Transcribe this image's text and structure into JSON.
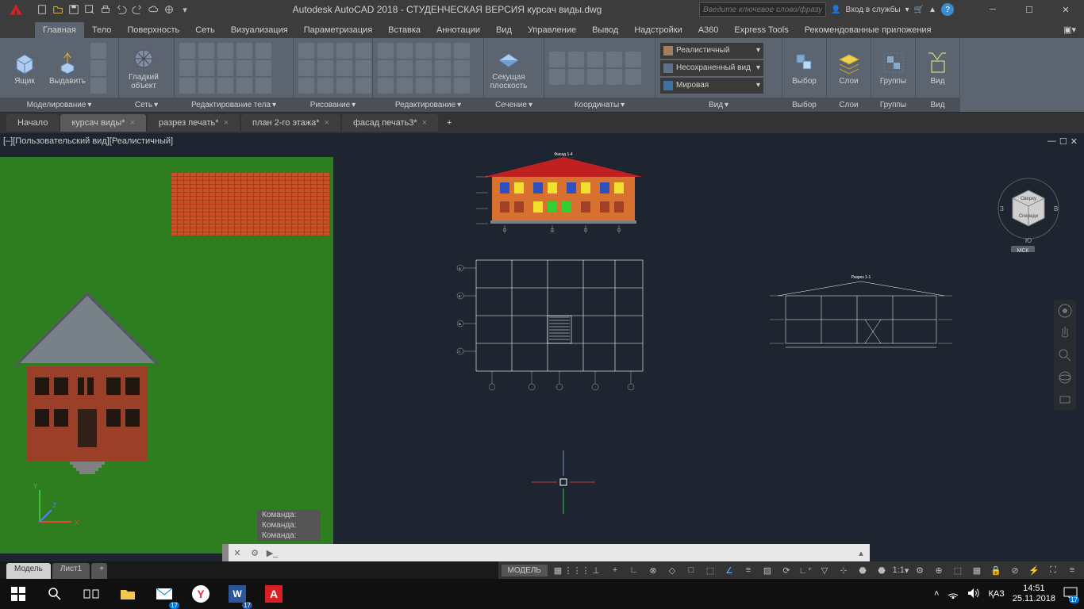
{
  "title": "Autodesk AutoCAD 2018 - СТУДЕНЧЕСКАЯ ВЕРСИЯ   курсач виды.dwg",
  "search_placeholder": "Введите ключевое слово/фразу",
  "signin": "Вход в службы",
  "ribbon_tabs": [
    "Главная",
    "Тело",
    "Поверхность",
    "Сеть",
    "Визуализация",
    "Параметризация",
    "Вставка",
    "Аннотации",
    "Вид",
    "Управление",
    "Вывод",
    "Надстройки",
    "A360",
    "Express Tools",
    "Рекомендованные приложения"
  ],
  "panels": {
    "modeling": "Моделирование",
    "mesh": "Сеть",
    "solid_edit": "Редактирование тела",
    "draw": "Рисование",
    "modify": "Редактирование",
    "section": "Сечение",
    "coords": "Координаты",
    "view": "Вид",
    "sel": "Выбор",
    "layers": "Слои",
    "groups": "Группы",
    "view2": "Вид"
  },
  "big_buttons": {
    "box": "Ящик",
    "extrude": "Выдавить",
    "smooth": "Гладкий объект",
    "section_plane": "Секущая плоскость",
    "select": "Выбор",
    "layers": "Слои",
    "groups": "Группы",
    "view": "Вид"
  },
  "dropdowns": {
    "visual_style": "Реалистичный",
    "saved_view": "Несохраненный вид",
    "ucs": "Мировая"
  },
  "file_tabs": [
    "Начало",
    "курсач виды*",
    "разрез печать*",
    "план 2-го этажа*",
    "фасад печать3*"
  ],
  "active_file": 1,
  "view_label": "[–][Пользовательский вид][Реалистичный]",
  "cmd_prompt": "Команда:",
  "model_tabs": [
    "Модель",
    "Лист1"
  ],
  "status_model": "МОДЕЛЬ",
  "scale": "1:1",
  "viewcube": {
    "top": "Сверху",
    "front": "Спереди",
    "w": "З",
    "e": "В",
    "s": "Ю",
    "wcs": "МСК"
  },
  "taskbar": {
    "lang": "ҚАЗ",
    "time": "14:51",
    "date": "25.11.2018",
    "badge": "17"
  },
  "facade_label": "Фасад 1-4",
  "section_label": "Разрез 1-1"
}
